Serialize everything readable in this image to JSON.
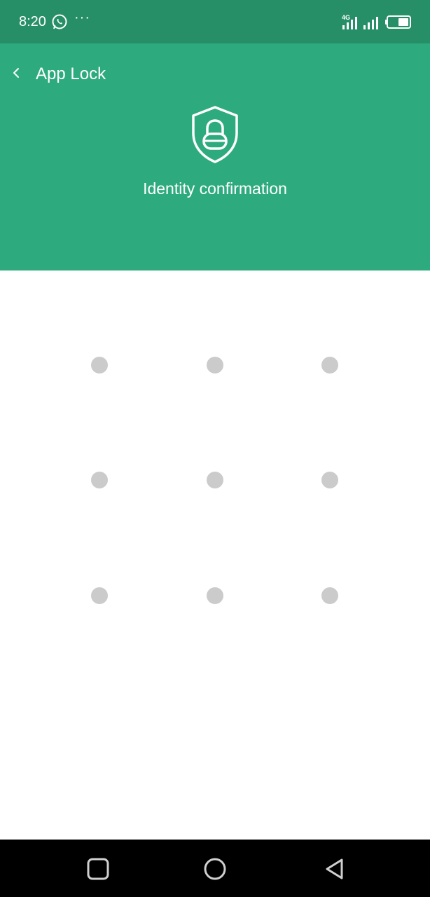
{
  "status_bar": {
    "time": "8:20",
    "more": "···",
    "network": "4G",
    "icons": [
      "whatsapp-icon",
      "signal-icon",
      "signal-icon",
      "battery-icon"
    ]
  },
  "header": {
    "title": "App Lock",
    "back_icon": "chevron-left-icon",
    "shield_icon": "shield-lock-icon",
    "message": "Identity confirmation",
    "background_color": "#2eab7e",
    "status_bar_color": "#278f68"
  },
  "pattern": {
    "dot_color": "#cbcbcb",
    "rows": 3,
    "columns": 3
  },
  "nav_bar": {
    "icons": [
      "recent-apps-icon",
      "home-icon",
      "back-icon"
    ]
  }
}
